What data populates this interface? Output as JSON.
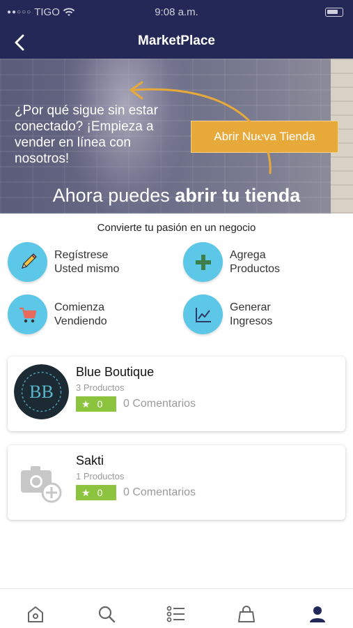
{
  "status_bar": {
    "carrier": "TIGO",
    "time": "9:08 a.m."
  },
  "nav": {
    "title": "MarketPlace",
    "back_icon": "chevron-left-icon"
  },
  "hero": {
    "tagline": "¿Por qué sigue sin estar conectado? ¡Empieza a vender en línea con nosotros!",
    "cta_label": "Abrir Nueva Tienda",
    "headline_regular": "Ahora puedes ",
    "headline_bold": "abrir tu tienda",
    "accent_color": "#e6a93a"
  },
  "subtitle": "Convierte tu pasión en un negocio",
  "features": [
    {
      "icon": "pencil-icon",
      "line1": "Regístrese",
      "line2": "Usted mismo"
    },
    {
      "icon": "plus-icon",
      "line1": "Agrega",
      "line2": "Productos"
    },
    {
      "icon": "cart-icon",
      "line1": "Comienza",
      "line2": "Vendiendo"
    },
    {
      "icon": "chart-icon",
      "line1": "Generar",
      "line2": "Ingresos"
    }
  ],
  "stores": [
    {
      "name": "Blue Boutique",
      "products": "3  Productos",
      "rating": "0",
      "comments": "0 Comentarios",
      "logo_text": "BB"
    },
    {
      "name": "Sakti",
      "products": "1  Productos",
      "rating": "0",
      "comments": "0 Comentarios"
    }
  ],
  "tabs": [
    {
      "icon": "home-icon"
    },
    {
      "icon": "search-icon"
    },
    {
      "icon": "list-icon"
    },
    {
      "icon": "bag-icon"
    },
    {
      "icon": "profile-icon",
      "active": true
    }
  ],
  "colors": {
    "header_bg": "#232856",
    "feature_circle": "#5cc7e6",
    "rating_bg": "#8cc43f"
  }
}
